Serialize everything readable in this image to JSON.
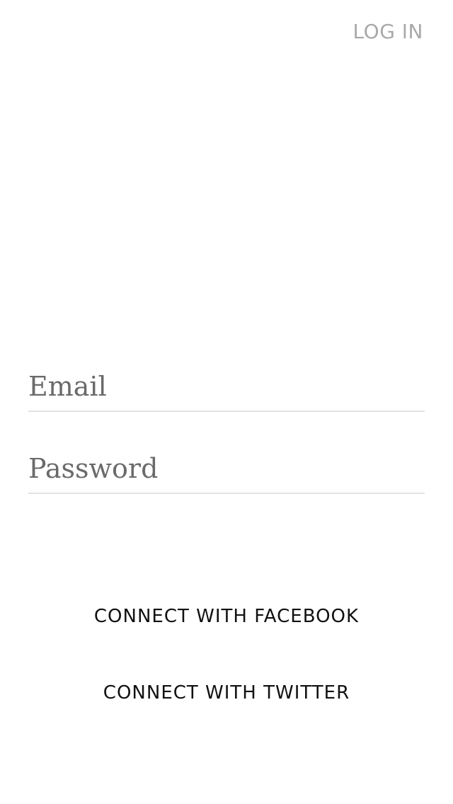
{
  "header": {
    "login_label": "LOG IN"
  },
  "form": {
    "email_placeholder": "Email",
    "email_value": "",
    "password_placeholder": "Password",
    "password_value": ""
  },
  "social": {
    "facebook_label": "CONNECT WITH FACEBOOK",
    "twitter_label": "CONNECT WITH TWITTER"
  },
  "colors": {
    "background": "#ffffff",
    "login_link": "#a9a9a9",
    "placeholder": "#6a6a6a",
    "divider": "#e2e2e2",
    "button_text": "#111111"
  }
}
